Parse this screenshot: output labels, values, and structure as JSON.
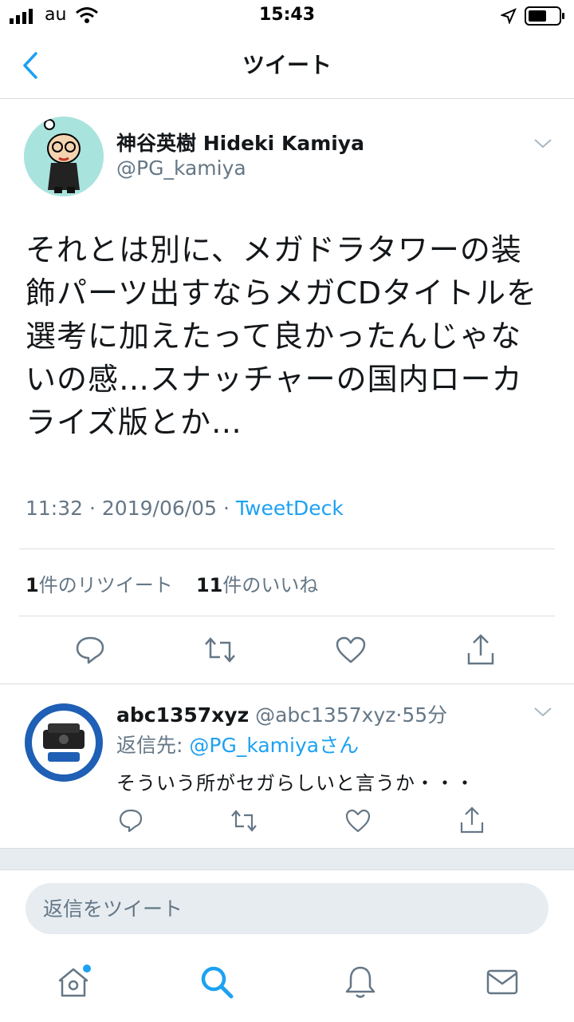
{
  "status_bar": {
    "carrier": "au",
    "time": "15:43"
  },
  "header": {
    "title": "ツイート"
  },
  "tweet": {
    "author_name": "神谷英樹 Hideki Kamiya",
    "author_handle": "@PG_kamiya",
    "text": "それとは別に、メガドラタワーの装飾パーツ出すならメガCDタイトルを選考に加えたって良かったんじゃないの感…スナッチャーの国内ローカライズ版とか…",
    "time": "11:32",
    "date": "2019/06/05",
    "source": "TweetDeck",
    "retweet_count": "1",
    "retweet_label": "件のリツイート",
    "like_count": "11",
    "like_label": "件のいいね"
  },
  "reply": {
    "author_name": "abc1357xyz",
    "author_handle": "@abc1357xyz",
    "time": "55分",
    "reply_to_label": "返信先: ",
    "reply_to_handle": "@PG_kamiyaさん",
    "text": "そういう所がセガらしいと言うか・・・"
  },
  "composer": {
    "placeholder": "返信をツイート"
  },
  "colors": {
    "accent": "#1da1f2",
    "muted": "#657786",
    "text": "#14171a"
  },
  "icons": [
    "back-chevron-icon",
    "chevron-down-icon",
    "reply-icon",
    "retweet-icon",
    "like-icon",
    "share-icon",
    "home-icon",
    "search-icon",
    "notifications-icon",
    "messages-icon"
  ]
}
